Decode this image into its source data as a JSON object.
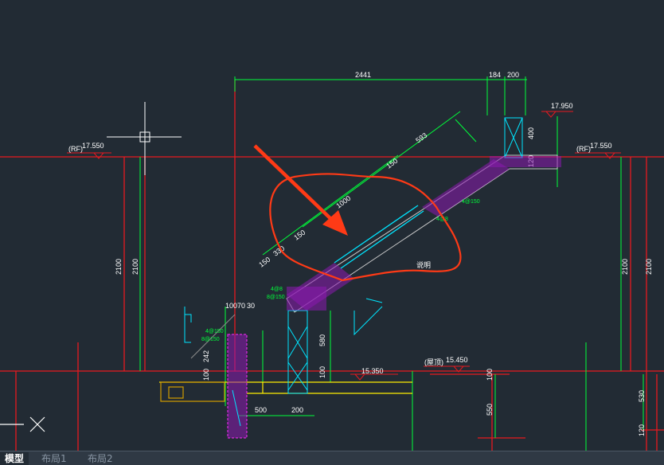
{
  "colors": {
    "background": "#222b34",
    "grid_red": "#e8191f",
    "dimension_green": "#00ff3a",
    "annotation_cyan": "#00e5ff",
    "rebar_magenta": "#ff2bff",
    "slab_yellow": "#ffee00",
    "markup_orange": "#ff3a16"
  },
  "dimensions": {
    "top_span": "2441",
    "top_184": "184",
    "top_200": "200",
    "diag_593": "593",
    "diag_150_top": "150",
    "diag_1000": "1000",
    "diag_150_mid": "150",
    "diag_330": "330",
    "diag_150_low": "150",
    "left_2100_a": "2100",
    "left_2100_b": "2100",
    "right_2100_a": "2100",
    "right_2100_b": "2100",
    "bottom_500": "500",
    "bottom_200": "200",
    "v_580": "580",
    "v_100": "100",
    "top_left_100": "10070",
    "top_left_30": "30",
    "v_400": "400",
    "v_120": "120",
    "v_550": "550",
    "v_100_right": "100",
    "v_530": "530",
    "v_120_right": "120",
    "v_242": "242",
    "v_100_left": "100"
  },
  "elevations": {
    "rf_left_tag": "(RF)",
    "rf_left_value": "17.550",
    "rf_right_tag": "(RF)",
    "rf_right_value": "17.550",
    "top_right": "17.950",
    "floor_right": "15.350",
    "lower_tag": "(屋顶)",
    "lower_value": "15.450"
  },
  "labels": {
    "annot_mid": "说明",
    "rebar_a": "4@150",
    "rebar_b": "8@150",
    "rebar_c": "4@8",
    "rebar_d": "8@150",
    "rebar_e": "4@150",
    "rebar_f": "4@8"
  },
  "tabs": {
    "model": "模型",
    "layout1": "布局1",
    "layout2": "布局2"
  }
}
